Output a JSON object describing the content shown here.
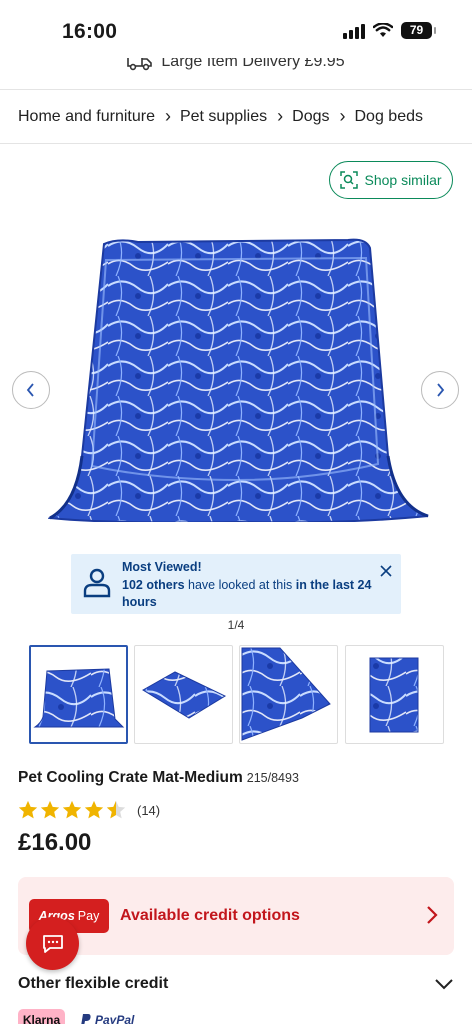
{
  "status_bar": {
    "time": "16:00",
    "battery": "79"
  },
  "delivery": {
    "text": "Large Item Delivery £9.95",
    "icon": "truck-icon"
  },
  "breadcrumb": [
    "Home and furniture",
    "Pet supplies",
    "Dogs",
    "Dog beds"
  ],
  "shop_similar": {
    "label": "Shop similar",
    "icon": "visual-search-icon"
  },
  "colors": {
    "brand_red": "#d41f1f",
    "accent_green": "#0b8a5a",
    "info_blue": "#0a3e80",
    "star_gold": "#f0b400"
  },
  "most_viewed": {
    "title": "Most Viewed!",
    "count_text": "102 others",
    "middle_text": " have looked at this ",
    "period_text": "in the last 24 hours"
  },
  "gallery": {
    "pager": "1/4",
    "thumbnail_count": 4
  },
  "product": {
    "title": "Pet Cooling Crate Mat-Medium",
    "code": "215/8493",
    "rating": 4.5,
    "review_count": "(14)",
    "price": "£16.00"
  },
  "credit": {
    "badge_brand": "Argos",
    "badge_pay": "Pay",
    "label": "Available credit options"
  },
  "other_credit": {
    "label": "Other flexible credit"
  },
  "payment_logos": {
    "klarna": "Klarna",
    "paypal": "PayPal"
  }
}
